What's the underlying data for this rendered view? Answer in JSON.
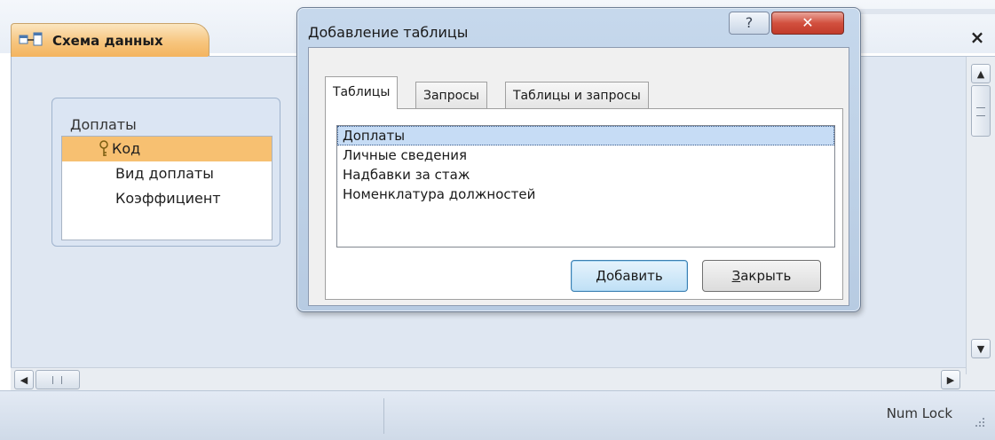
{
  "document": {
    "tab_label": "Схема данных",
    "tab_icon": "relationships-icon",
    "close_glyph": "×"
  },
  "relationship_table": {
    "title": "Доплаты",
    "fields": [
      {
        "label": "Код",
        "primary_key": true,
        "selected": true
      },
      {
        "label": "Вид доплаты",
        "primary_key": false,
        "selected": false
      },
      {
        "label": "Коэффициент",
        "primary_key": false,
        "selected": false
      }
    ]
  },
  "dialog": {
    "title": "Добавление таблицы",
    "help_glyph": "?",
    "close_glyph": "✕",
    "tabs": [
      {
        "label": "Таблицы",
        "active": true
      },
      {
        "label": "Запросы",
        "active": false
      },
      {
        "label": "Таблицы и запросы",
        "active": false
      }
    ],
    "list_items": [
      {
        "label": "Доплаты",
        "selected": true
      },
      {
        "label": "Личные сведения",
        "selected": false
      },
      {
        "label": "Надбавки за стаж",
        "selected": false
      },
      {
        "label": "Номенклатура должностей",
        "selected": false
      }
    ],
    "add_button": {
      "label": "Добавить",
      "accel": "Д",
      "rest": "обавить"
    },
    "close_button": {
      "label": "Закрыть",
      "accel": "З",
      "rest": "акрыть"
    }
  },
  "status_bar": {
    "numlock": "Num Lock"
  },
  "colors": {
    "tab_accent": "#f7c57e",
    "selected_field": "#f7c071",
    "canvas": "#dfe7f2",
    "dialog_frame": "#c6d8ec",
    "close_button": "#d2503f",
    "default_button_border": "#3c7fb1"
  },
  "icons": {
    "key": "key-icon",
    "scroll_up": "scroll-up-icon",
    "scroll_down": "scroll-down-icon",
    "scroll_left": "scroll-left-icon",
    "scroll_right": "scroll-right-icon",
    "size_grip": "size-grip-icon"
  }
}
